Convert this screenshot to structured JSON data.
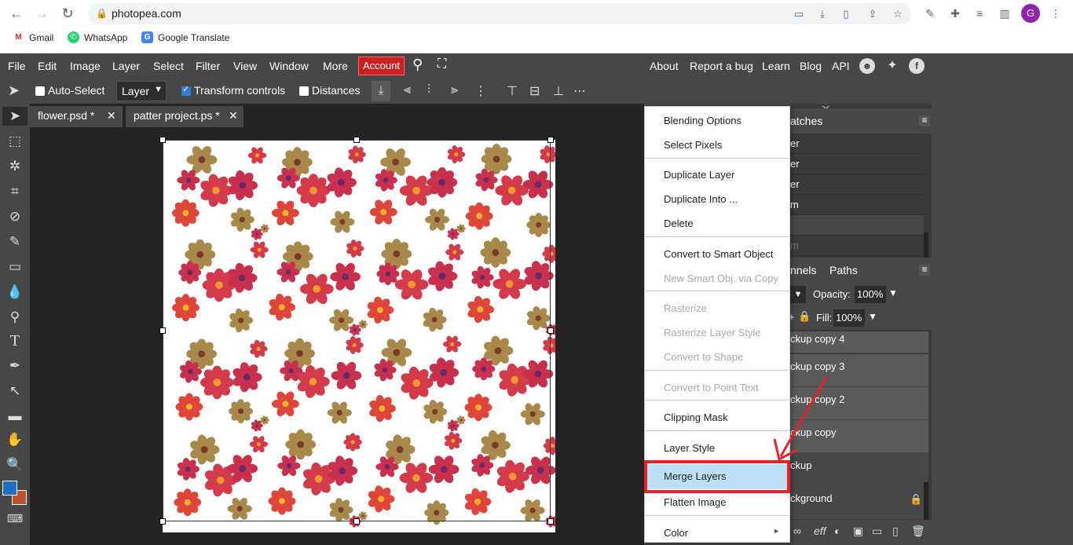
{
  "browser": {
    "url": "photopea.com",
    "avatar_letter": "G",
    "bookmarks": [
      "Gmail",
      "WhatsApp",
      "Google Translate"
    ]
  },
  "menu": {
    "items": [
      "File",
      "Edit",
      "Image",
      "Layer",
      "Select",
      "Filter",
      "View",
      "Window",
      "More"
    ],
    "account": "Account",
    "right": [
      "About",
      "Report a bug",
      "Learn",
      "Blog",
      "API"
    ]
  },
  "options": {
    "auto_select": "Auto-Select",
    "layer_select": "Layer",
    "transform": "Transform controls",
    "distances": "Distances"
  },
  "tabs": [
    {
      "label": "flower.psd *"
    },
    {
      "label": "patter project.ps *"
    }
  ],
  "panels": {
    "swatches_tab": "atches",
    "swatch_rows": [
      "er",
      "er",
      "er",
      "m",
      "",
      "m"
    ],
    "channels_tab": "nnels",
    "paths_tab": "Paths",
    "opacity_label": "Opacity:",
    "opacity_value": "100%",
    "fill_label": "Fill:",
    "fill_value": "100%",
    "layers": [
      "ckup copy 4",
      "ckup copy 3",
      "ckup copy 2",
      "ckup copy",
      "ckup",
      "ckground"
    ]
  },
  "context_menu": {
    "items": [
      {
        "label": "Blending Options",
        "disabled": false
      },
      {
        "label": "Select Pixels",
        "disabled": false
      },
      {
        "label": "Duplicate Layer",
        "disabled": false
      },
      {
        "label": "Duplicate Into ...",
        "disabled": false
      },
      {
        "label": "Delete",
        "disabled": false
      },
      {
        "label": "Convert to Smart Object",
        "disabled": false
      },
      {
        "label": "New Smart Obj. via Copy",
        "disabled": true
      },
      {
        "label": "Rasterize",
        "disabled": true
      },
      {
        "label": "Rasterize Layer Style",
        "disabled": true
      },
      {
        "label": "Convert to Shape",
        "disabled": true
      },
      {
        "label": "Convert to Point Text",
        "disabled": true
      },
      {
        "label": "Clipping Mask",
        "disabled": false
      },
      {
        "label": "Layer Style",
        "disabled": false
      },
      {
        "label": "Merge Layers",
        "disabled": false,
        "highlighted": true
      },
      {
        "label": "Flatten Image",
        "disabled": false
      },
      {
        "label": "Color",
        "disabled": false,
        "submenu": true
      }
    ]
  },
  "colors": {
    "foreground": "#1e6fc7",
    "background": "#c0522a",
    "highlight": "#bde0f7",
    "annotation": "#e2232a"
  }
}
